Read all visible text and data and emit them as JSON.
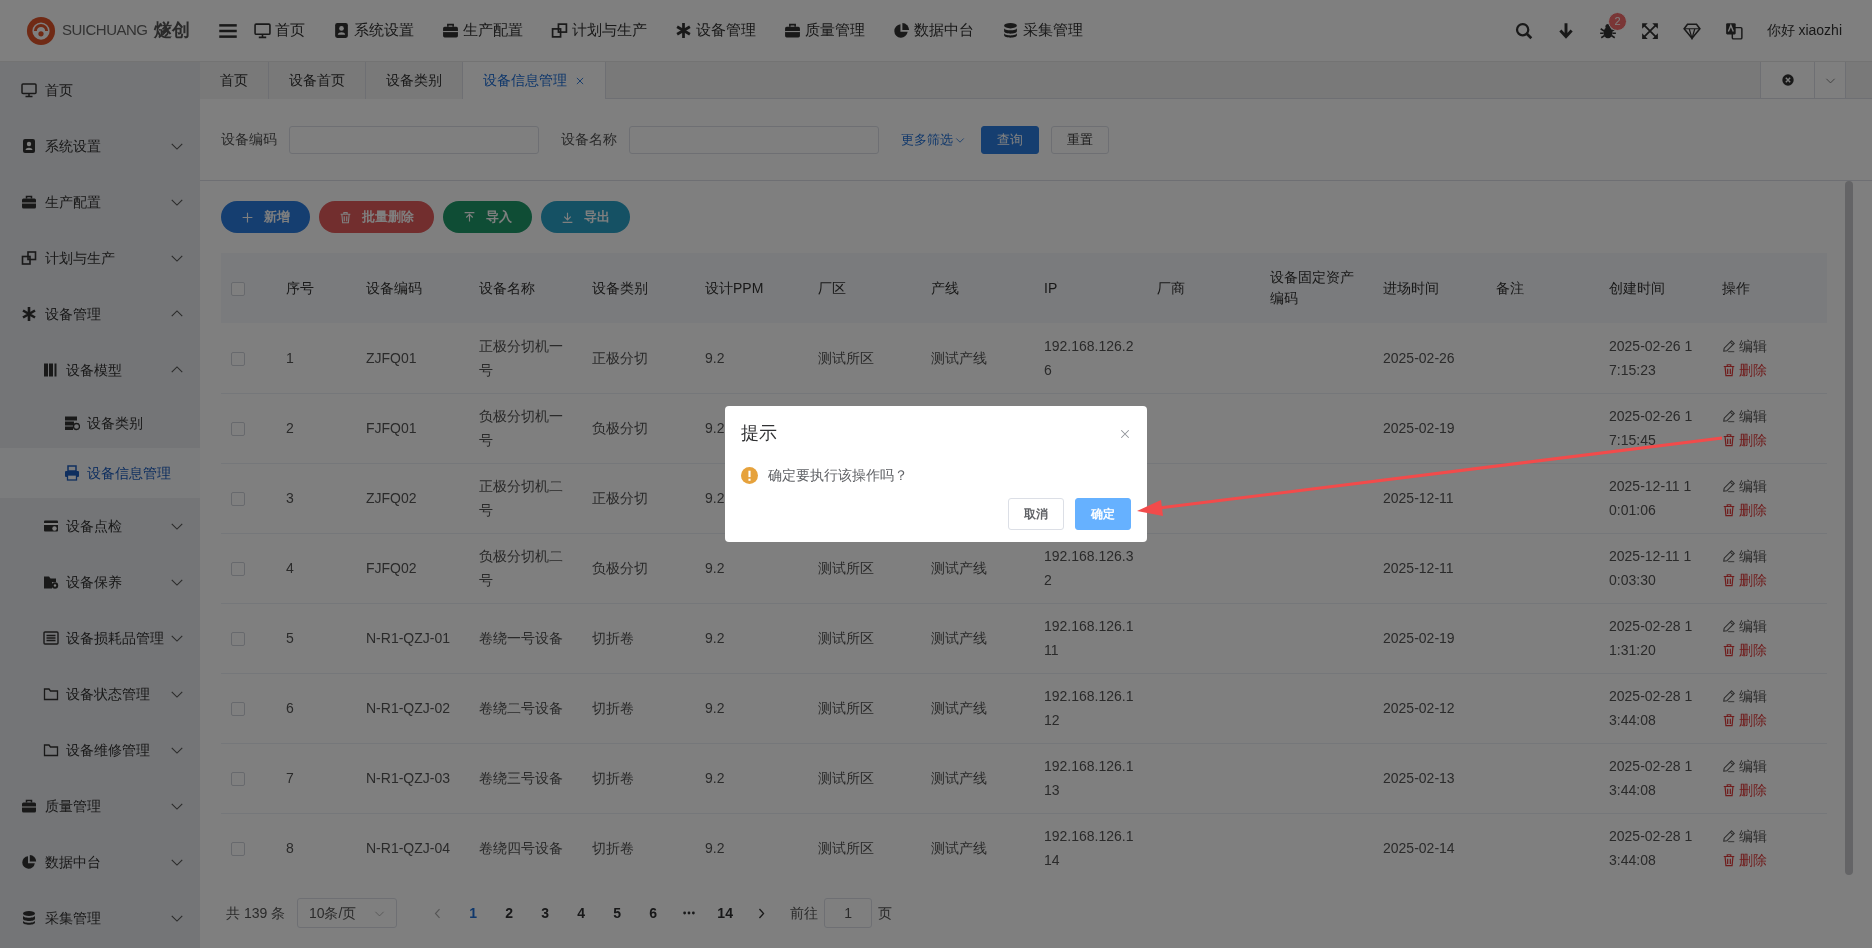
{
  "header": {
    "logo": {
      "latin": "SUICHUANG",
      "chinese": "燧创"
    },
    "nav": [
      {
        "label": "首页"
      },
      {
        "label": "系统设置"
      },
      {
        "label": "生产配置"
      },
      {
        "label": "计划与生产"
      },
      {
        "label": "设备管理"
      },
      {
        "label": "质量管理"
      },
      {
        "label": "数据中台"
      },
      {
        "label": "采集管理"
      }
    ],
    "notification_count": "2",
    "user": "你好 xiaozhi"
  },
  "sidebar": {
    "items": [
      {
        "label": "首页",
        "kind": "link",
        "selected": false
      },
      {
        "label": "系统设置",
        "kind": "group",
        "expanded": false,
        "selected": false
      },
      {
        "label": "生产配置",
        "kind": "group",
        "expanded": false,
        "selected": false
      },
      {
        "label": "计划与生产",
        "kind": "group",
        "expanded": false,
        "selected": false
      },
      {
        "label": "设备管理",
        "kind": "group",
        "expanded": true,
        "selected": false,
        "children": [
          {
            "label": "设备模型",
            "kind": "group",
            "expanded": true,
            "selected": false,
            "children": [
              {
                "label": "设备类别",
                "kind": "link",
                "selected": false
              },
              {
                "label": "设备信息管理",
                "kind": "link",
                "selected": true
              }
            ]
          },
          {
            "label": "设备点检",
            "kind": "group",
            "expanded": false,
            "selected": false
          },
          {
            "label": "设备保养",
            "kind": "group",
            "expanded": false,
            "selected": false
          },
          {
            "label": "设备损耗品管理",
            "kind": "group",
            "expanded": false,
            "selected": false
          },
          {
            "label": "设备状态管理",
            "kind": "group",
            "expanded": false,
            "selected": false
          },
          {
            "label": "设备维修管理",
            "kind": "group",
            "expanded": false,
            "selected": false
          }
        ]
      },
      {
        "label": "质量管理",
        "kind": "group",
        "expanded": false,
        "selected": false
      },
      {
        "label": "数据中台",
        "kind": "group",
        "expanded": false,
        "selected": false
      },
      {
        "label": "采集管理",
        "kind": "group",
        "expanded": false,
        "selected": false
      }
    ]
  },
  "tabs": [
    {
      "label": "首页",
      "selected": false,
      "closable": false
    },
    {
      "label": "设备首页",
      "selected": false,
      "closable": false
    },
    {
      "label": "设备类别",
      "selected": false,
      "closable": false
    },
    {
      "label": "设备信息管理",
      "selected": true,
      "closable": true
    }
  ],
  "filters": {
    "fields": [
      {
        "label": "设备编码"
      },
      {
        "label": "设备名称"
      }
    ],
    "more": "更多筛选",
    "search_button": "查询",
    "reset_button": "重置"
  },
  "actions": [
    {
      "label": "新增",
      "kind": "add"
    },
    {
      "label": "批量删除",
      "kind": "delete"
    },
    {
      "label": "导入",
      "kind": "import"
    },
    {
      "label": "导出",
      "kind": "export"
    }
  ],
  "table": {
    "header_checked": false,
    "columns": [
      "序号",
      "设备编码",
      "设备名称",
      "设备类别",
      "设计PPM",
      "厂区",
      "产线",
      "IP",
      "厂商",
      "设备固定资产编码",
      "进场时间",
      "备注",
      "创建时间",
      "操作"
    ],
    "rows": [
      {
        "checked": false,
        "no": "1",
        "code": "ZJFQ01",
        "name": "正极分切机一号",
        "category": "正极分切",
        "ppm": "9.2",
        "plant": "测试所区",
        "line": "测试产线",
        "ip": "192.168.126.26",
        "entry_date": "2025-02-26",
        "created": "2025-02-26 17:15:23",
        "edit": "编辑",
        "delete": "删除"
      },
      {
        "checked": false,
        "no": "2",
        "code": "FJFQ01",
        "name": "负极分切机一号",
        "category": "负极分切",
        "ppm": "9.2",
        "entry_date": "2025-02-19",
        "created": "2025-02-26 17:15:45",
        "edit": "编辑",
        "delete": "删除"
      },
      {
        "checked": false,
        "no": "3",
        "code": "ZJFQ02",
        "name": "正极分切机二号",
        "category": "正极分切",
        "ppm": "9.2",
        "entry_date": "2025-12-11",
        "created": "2025-12-11 10:01:06",
        "edit": "编辑",
        "delete": "删除"
      },
      {
        "checked": false,
        "no": "4",
        "code": "FJFQ02",
        "name": "负极分切机二号",
        "category": "负极分切",
        "ppm": "9.2",
        "plant": "测试所区",
        "line": "测试产线",
        "ip": "192.168.126.32",
        "entry_date": "2025-12-11",
        "created": "2025-12-11 10:03:30",
        "edit": "编辑",
        "delete": "删除"
      },
      {
        "checked": false,
        "no": "5",
        "code": "N-R1-QZJ-01",
        "name": "卷绕一号设备",
        "category": "切折卷",
        "ppm": "9.2",
        "plant": "测试所区",
        "line": "测试产线",
        "ip": "192.168.126.111",
        "entry_date": "2025-02-19",
        "created": "2025-02-28 11:31:20",
        "edit": "编辑",
        "delete": "删除"
      },
      {
        "checked": false,
        "no": "6",
        "code": "N-R1-QZJ-02",
        "name": "卷绕二号设备",
        "category": "切折卷",
        "ppm": "9.2",
        "plant": "测试所区",
        "line": "测试产线",
        "ip": "192.168.126.112",
        "entry_date": "2025-02-12",
        "created": "2025-02-28 13:44:08",
        "edit": "编辑",
        "delete": "删除"
      },
      {
        "checked": false,
        "no": "7",
        "code": "N-R1-QZJ-03",
        "name": "卷绕三号设备",
        "category": "切折卷",
        "ppm": "9.2",
        "plant": "测试所区",
        "line": "测试产线",
        "ip": "192.168.126.113",
        "entry_date": "2025-02-13",
        "created": "2025-02-28 13:44:08",
        "edit": "编辑",
        "delete": "删除"
      },
      {
        "checked": false,
        "no": "8",
        "code": "N-R1-QZJ-04",
        "name": "卷绕四号设备",
        "category": "切折卷",
        "ppm": "9.2",
        "plant": "测试所区",
        "line": "测试产线",
        "ip": "192.168.126.114",
        "entry_date": "2025-02-14",
        "created": "2025-02-28 13:44:08",
        "edit": "编辑",
        "delete": "删除"
      }
    ]
  },
  "pagination": {
    "total": "共 139 条",
    "page_size": "10条/页",
    "pages": [
      {
        "kind": "page",
        "label": "1",
        "selected": true
      },
      {
        "kind": "page",
        "label": "2",
        "selected": false
      },
      {
        "kind": "page",
        "label": "3",
        "selected": false
      },
      {
        "kind": "page",
        "label": "4",
        "selected": false
      },
      {
        "kind": "page",
        "label": "5",
        "selected": false
      },
      {
        "kind": "page",
        "label": "6",
        "selected": false
      },
      {
        "kind": "more",
        "selected": false
      },
      {
        "kind": "page",
        "label": "14",
        "selected": false
      }
    ],
    "goto_label": "前往",
    "goto_value": "1",
    "goto_suffix": "页"
  },
  "dialog": {
    "title": "提示",
    "message": "确定要执行该操作吗？",
    "buttons": [
      {
        "label": "取消",
        "kind": "cancel"
      },
      {
        "label": "确定",
        "kind": "confirm"
      }
    ]
  }
}
